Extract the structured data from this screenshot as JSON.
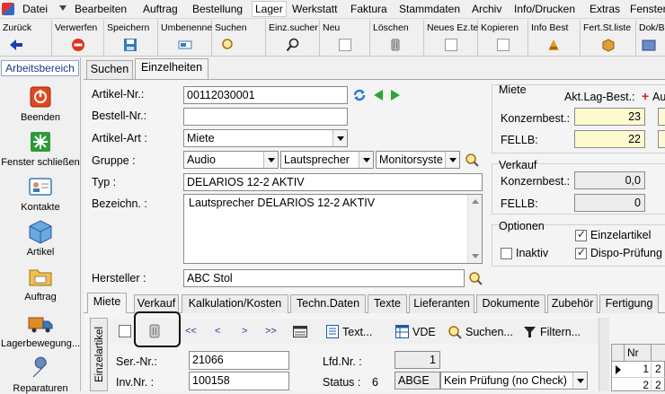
{
  "menu": [
    "Datei",
    "Bearbeiten",
    "Auftrag",
    "Bestellung",
    "Lager",
    "Werkstatt",
    "Faktura",
    "Stammdaten",
    "Archiv",
    "Info/Drucken",
    "Extras",
    "Fenster"
  ],
  "toolbar": [
    {
      "label": "Zurück",
      "icon": "back-arrow-icon"
    },
    {
      "label": "Verwerfen",
      "icon": "discard-icon"
    },
    {
      "label": "Speichern",
      "icon": "save-icon"
    },
    {
      "label": "Umbenenne",
      "icon": "rename-icon"
    },
    {
      "label": "Suchen",
      "icon": "search-icon"
    },
    {
      "label": "Einz.sucher",
      "icon": "magnifier-icon"
    },
    {
      "label": "Neu",
      "icon": "new-icon"
    },
    {
      "label": "Löschen",
      "icon": "trash-icon"
    },
    {
      "label": "Neues Ez.te",
      "icon": "new-item-icon"
    },
    {
      "label": "Kopieren",
      "icon": "copy-icon"
    },
    {
      "label": "Info Best",
      "icon": "info-icon"
    },
    {
      "label": "Fert.St.liste",
      "icon": "list-icon"
    },
    {
      "label": "Dok/B",
      "icon": "document-icon"
    }
  ],
  "sidebar": {
    "title": "Arbeitsbereich",
    "items": [
      "Beenden",
      "Fenster schließen",
      "Kontakte",
      "Artikel",
      "Auftrag",
      "Lagerbewegung...",
      "Reparaturen"
    ]
  },
  "top_tabs": [
    "Suchen",
    "Einzelheiten"
  ],
  "form": {
    "artikel_nr_label": "Artikel-Nr.:",
    "artikel_nr": "00112030001",
    "bestell_nr_label": "Bestell-Nr.:",
    "bestell_nr": "",
    "artikel_art_label": "Artikel-Art :",
    "artikel_art": "Miete",
    "gruppe_label": "Gruppe :",
    "gruppe1": "Audio",
    "gruppe2": "Lautsprecher",
    "gruppe3": "Monitorsyste",
    "typ_label": "Typ :",
    "typ": "DELARIOS 12-2 AKTIV",
    "bezeichn_label": "Bezeichn. :",
    "bezeichn": "Lautsprecher DELARIOS 12-2 AKTIV",
    "hersteller_label": "Hersteller :",
    "hersteller": "ABC Stol"
  },
  "miete": {
    "title": "Miete",
    "akt_label": "Akt.Lag-Best.:",
    "plus": "+",
    "au": "Au",
    "konzern_label": "Konzernbest.:",
    "konzern": "23",
    "fellb_label": "FELLB:",
    "fellb": "22"
  },
  "verkauf": {
    "title": "Verkauf",
    "konzern_label": "Konzernbest.:",
    "konzern": "0,0",
    "fellb_label": "FELLB:",
    "fellb": "0"
  },
  "optionen": {
    "title": "Optionen",
    "einzelartikel": "Einzelartikel",
    "inaktiv": "Inaktiv",
    "dispo": "Dispo-Prüfung"
  },
  "bottom_tabs": [
    "Miete",
    "Verkauf",
    "Kalkulation/Kosten",
    "Techn.Daten",
    "Texte",
    "Lieferanten",
    "Dokumente",
    "Zubehör",
    "Fertigung"
  ],
  "sub": {
    "vertical": "Einzelartikel",
    "nav": [
      "<<",
      "<",
      ">",
      ">>"
    ],
    "text_btn": "Text...",
    "vde_btn": "VDE",
    "suchen_btn": "Suchen...",
    "filter_btn": "Filtern...",
    "ser_label": "Ser.-Nr.:",
    "ser": "21066",
    "inv_label": "Inv.Nr. :",
    "inv": "100158",
    "lfd_label": "Lfd.Nr. :",
    "lfd": "1",
    "status_label": "Status :",
    "status_num": "6",
    "status_code": "ABGE",
    "status_text": "Kein Prüfung (no Check)",
    "grid_header": "Nr",
    "grid_rows": [
      "1",
      "2"
    ]
  }
}
